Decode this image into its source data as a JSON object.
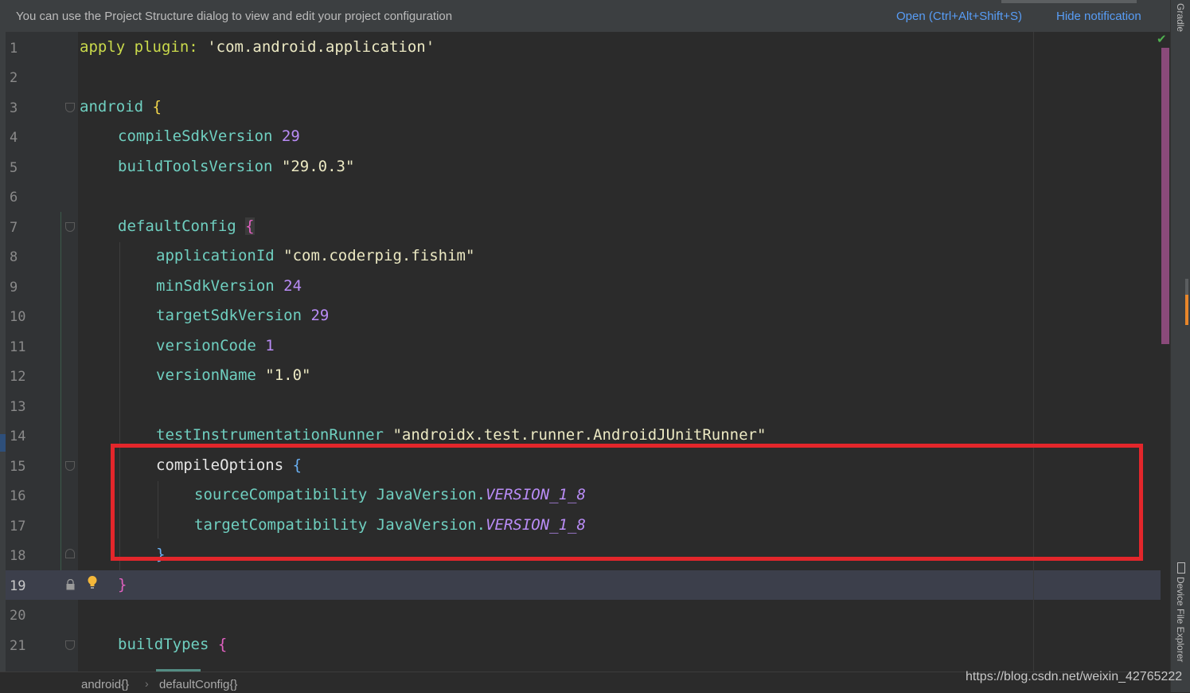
{
  "notification": {
    "message": "You can use the Project Structure dialog to view and edit your project configuration",
    "open_label": "Open (Ctrl+Alt+Shift+S)",
    "hide_label": "Hide notification"
  },
  "line_numbers": [
    "1",
    "2",
    "3",
    "4",
    "5",
    "6",
    "7",
    "8",
    "9",
    "10",
    "11",
    "12",
    "13",
    "14",
    "15",
    "16",
    "17",
    "18",
    "19",
    "20",
    "21"
  ],
  "code": {
    "l1_apply": "apply",
    "l1_plugin": "plugin:",
    "l1_str": "'com.android.application'",
    "l3_android": "android",
    "l3_brace": "{",
    "l4_key": "compileSdkVersion",
    "l4_val": "29",
    "l5_key": "buildToolsVersion",
    "l5_val": "\"29.0.3\"",
    "l7_key": "defaultConfig",
    "l7_brace": "{",
    "l8_key": "applicationId",
    "l8_val": "\"com.coderpig.fishim\"",
    "l9_key": "minSdkVersion",
    "l9_val": "24",
    "l10_key": "targetSdkVersion",
    "l10_val": "29",
    "l11_key": "versionCode",
    "l11_val": "1",
    "l12_key": "versionName",
    "l12_val": "\"1.0\"",
    "l14_key": "testInstrumentationRunner",
    "l14_val": "\"androidx.test.runner.AndroidJUnitRunner\"",
    "l15_key": "compileOptions",
    "l15_brace": "{",
    "l16_key": "sourceCompatibility",
    "l16_cls": "JavaVersion.",
    "l16_val": "VERSION_1_8",
    "l17_key": "targetCompatibility",
    "l17_cls": "JavaVersion.",
    "l17_val": "VERSION_1_8",
    "l18_brace": "}",
    "l19_brace": "}",
    "l21_key": "buildTypes",
    "l21_brace": "{"
  },
  "side_tools": {
    "gradle": "Gradle",
    "device_file_explorer": "Device File Explorer"
  },
  "breadcrumbs": [
    "android{}",
    "defaultConfig{}"
  ],
  "breadcrumb_separator": "›",
  "watermark": "https://blog.csdn.net/weixin_42765222"
}
